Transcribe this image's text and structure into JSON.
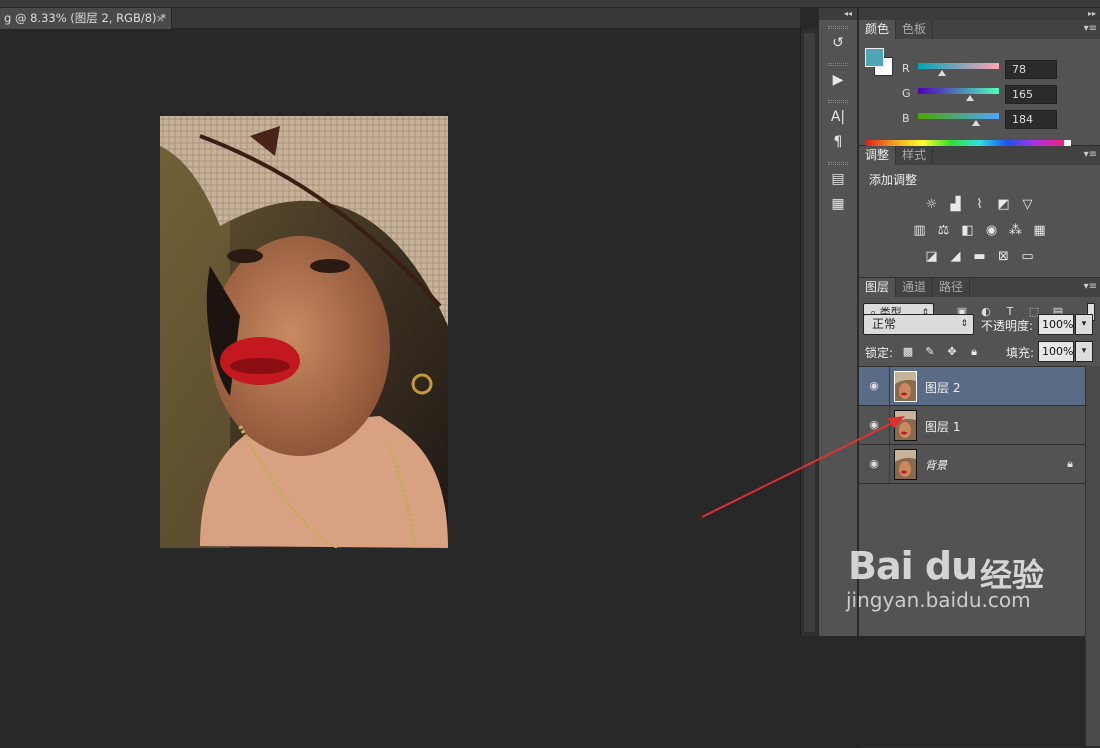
{
  "document": {
    "tab_title": "g @ 8.33% (图层 2, RGB/8) *",
    "close_glyph": "×"
  },
  "toolstrip": {
    "collapse_glyph": "◂◂",
    "icons": [
      "history-icon",
      "actions-icon",
      "character-icon",
      "paragraph-icon",
      "character-styles-icon",
      "paragraph-styles-icon"
    ]
  },
  "panels_header": {
    "collapse_glyph": "▸▸"
  },
  "color_panel": {
    "tabs": [
      "颜色",
      "色板"
    ],
    "menu_glyph": "▾≡",
    "foreground_color": "#4ea5b8",
    "background_color": "#ffffff",
    "channels": [
      {
        "label": "R",
        "value": "78"
      },
      {
        "label": "G",
        "value": "165"
      },
      {
        "label": "B",
        "value": "184"
      }
    ]
  },
  "adjustments_panel": {
    "tabs": [
      "调整",
      "样式"
    ],
    "menu_glyph": "▾≡",
    "title": "添加调整",
    "rows": [
      [
        "brightness-contrast-icon",
        "levels-icon",
        "curves-icon",
        "exposure-icon",
        "gradient-triangle-icon"
      ],
      [
        "vibrance-icon",
        "color-balance-icon",
        "black-white-icon",
        "photo-filter-icon",
        "channel-mixer-icon",
        "color-lookup-icon"
      ],
      [
        "invert-icon",
        "posterize-icon",
        "threshold-icon",
        "selective-color-icon",
        "gradient-map-icon"
      ]
    ]
  },
  "layers_panel": {
    "tabs": [
      "图层",
      "通道",
      "路径"
    ],
    "menu_glyph": "▾≡",
    "kind_filter": "类型",
    "blend_mode": "正常",
    "opacity_label": "不透明度:",
    "opacity_value": "100%",
    "lock_label": "锁定:",
    "fill_label": "填充:",
    "fill_value": "100%",
    "layers": [
      {
        "name": "图层 2",
        "selected": true,
        "locked": false
      },
      {
        "name": "图层 1",
        "selected": false,
        "locked": false
      },
      {
        "name": "背景",
        "selected": false,
        "locked": true
      }
    ]
  },
  "watermark": {
    "brand": "Bai du",
    "product": "经验",
    "url": "jingyan.baidu.com"
  },
  "annotation": {
    "color": "#e03030"
  }
}
